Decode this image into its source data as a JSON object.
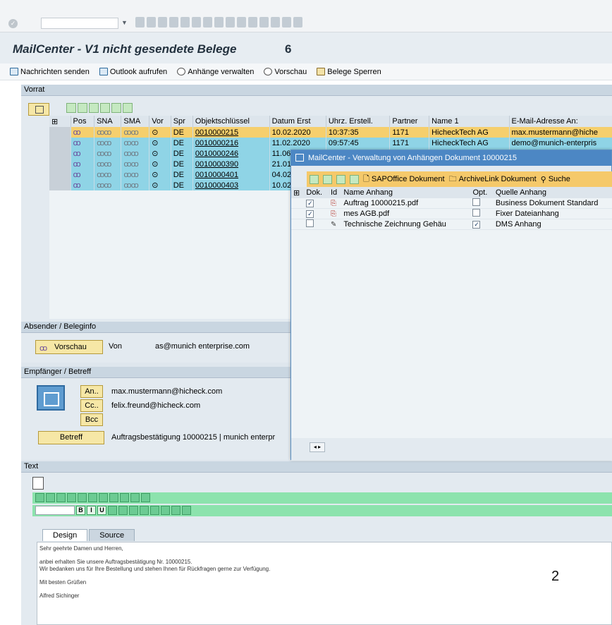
{
  "title": {
    "text": "MailCenter - V1 nicht gesendete Belege",
    "count": "6"
  },
  "toolbar": {
    "send_label": "Nachrichten senden",
    "outlook_label": "Outlook aufrufen",
    "attachments_label": "Anhänge verwalten",
    "preview_label": "Vorschau",
    "lock_label": "Belege Sperren"
  },
  "vorrat": {
    "header": "Vorrat",
    "columns": [
      "Pos",
      "SNA",
      "SMA",
      "Vor",
      "Spr",
      "Objektschlüssel",
      "Datum Erst",
      "Uhrz. Erstell.",
      "Partner",
      "Name 1",
      "E-Mail-Adresse An:"
    ],
    "rows": [
      {
        "spr": "DE",
        "key": "0010000215",
        "date": "10.02.2020",
        "time": "10:37:35",
        "partner": "1171",
        "name": "HicheckTech AG",
        "email": "max.mustermann@hiche"
      },
      {
        "spr": "DE",
        "key": "0010000216",
        "date": "11.02.2020",
        "time": "09:57:45",
        "partner": "1171",
        "name": "HicheckTech AG",
        "email": "demo@munich-enterpris"
      },
      {
        "spr": "DE",
        "key": "0010000246",
        "date": "11.06",
        "time": "",
        "partner": "",
        "name": "",
        "email": ""
      },
      {
        "spr": "DE",
        "key": "0010000390",
        "date": "21.01",
        "time": "",
        "partner": "",
        "name": "",
        "email": ""
      },
      {
        "spr": "DE",
        "key": "0010000401",
        "date": "04.02",
        "time": "",
        "partner": "",
        "name": "",
        "email": ""
      },
      {
        "spr": "DE",
        "key": "0010000403",
        "date": "10.02",
        "time": "",
        "partner": "",
        "name": "",
        "email": ""
      }
    ]
  },
  "absender": {
    "header": "Absender / Beleginfo",
    "preview_btn": "Vorschau",
    "von_label": "Von",
    "email": "as@munich enterprise.com"
  },
  "empfaenger": {
    "header": "Empfänger / Betreff",
    "an_btn": "An..",
    "cc_btn": "Cc..",
    "bcc_btn": "Bcc",
    "an_value": "max.mustermann@hicheck.com",
    "cc_value": "felix.freund@hicheck.com",
    "betreff_btn": "Betreff",
    "betreff_value": "Auftragsbestätigung 10000215 | munich enterpr"
  },
  "text": {
    "header": "Text",
    "tab_design": "Design",
    "tab_source": "Source",
    "body": [
      "Sehr geehrte Damen und Herren,",
      "anbei erhalten Sie unsere Auftragsbestätigung Nr. 10000215.",
      "Wir bedanken uns für Ihre Bestellung und stehen Ihnen für Rückfragen gerne zur Verfügung.",
      "Mit besten Grüßen",
      "Alfred Sichinger"
    ]
  },
  "popup": {
    "title": "MailCenter - Verwaltung von Anhängen Dokument 10000215",
    "sapoffice_btn": "SAPOffice Dokument",
    "archivelink_btn": "ArchiveLink Dokument",
    "search_btn": "Suche",
    "columns": [
      "Dok.",
      "Id",
      "Name Anhang",
      "Opt.",
      "Quelle Anhang"
    ],
    "rows": [
      {
        "dok": true,
        "name": "Auftrag 10000215.pdf",
        "opt": false,
        "source": "Business Dokument Standard"
      },
      {
        "dok": true,
        "name": "mes AGB.pdf",
        "opt": false,
        "source": "Fixer Dateianhang"
      },
      {
        "dok": false,
        "name": "Technische Zeichnung Gehäu",
        "opt": true,
        "source": "DMS Anhang"
      }
    ]
  },
  "page_number": "2"
}
